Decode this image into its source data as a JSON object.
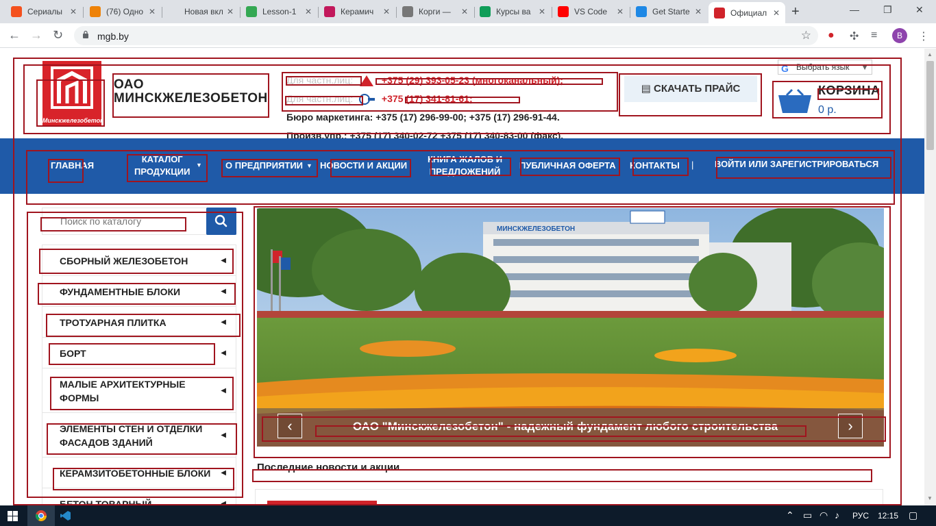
{
  "browser": {
    "tabs": [
      {
        "title": "Сериалы",
        "icon": "fox-icon",
        "color": "#f4511e"
      },
      {
        "title": "(76) Одно",
        "icon": "odnoklassniki-icon",
        "color": "#ee8208"
      },
      {
        "title": "Новая вкладк",
        "icon": "",
        "color": ""
      },
      {
        "title": "Lesson-1",
        "icon": "google-drive-icon",
        "color": "#34a853"
      },
      {
        "title": "Керамич",
        "icon": "ceramic-site-icon",
        "color": "#c2185b"
      },
      {
        "title": "Корги —",
        "icon": "corgi-icon",
        "color": "#777777"
      },
      {
        "title": "Курсы ва",
        "icon": "sheets-icon",
        "color": "#0f9d58"
      },
      {
        "title": "VS Code",
        "icon": "youtube-icon",
        "color": "#ff0000"
      },
      {
        "title": "Get Starte",
        "icon": "vscode-icon",
        "color": "#1e88e5"
      },
      {
        "title": "Официал",
        "icon": "mgb-icon",
        "color": "#d0232a"
      }
    ],
    "url": "mgb.by",
    "profile_initial": "B"
  },
  "site": {
    "company_line1": "ОАО",
    "company_line2": "МИНСКЖЕЛЕЗОБЕТОН",
    "logo_caption": "Минскжелезобетон",
    "phones": {
      "line1_label": "Для частн.лиц:",
      "line1_number": "+375 (29) 393-05-23 (многоканальный);",
      "line2_label": "Для частн.лиц:",
      "line2_number": "+375 (17) 341-81-61;",
      "line3": "Бюро маркетинга: +375 (17) 296-99-00; +375 (17) 296-91-44.",
      "line4": "Произв.упр.: +375 (17) 340-02-72 +375 (17) 340-83-00 (факс)."
    },
    "price_button": "СКАЧАТЬ ПРАЙС",
    "language_button": "Выбрать язык",
    "cart_title": "КОРЗИНА",
    "cart_sum": "0 р.",
    "nav": {
      "home": "ГЛАВНАЯ",
      "catalog_1": "КАТАЛОГ",
      "catalog_2": "ПРОДУКЦИИ",
      "about": "О ПРЕДПРИЯТИИ",
      "news": "НОВОСТИ И АКЦИИ",
      "complaints_1": "КНИГА ЖАЛОВ И",
      "complaints_2": "ПРЕДЛОЖЕНИЙ",
      "offer": "ПУБЛИЧНАЯ ОФЕРТА",
      "contacts": "КОНТАКТЫ",
      "login": "ВОЙТИ ИЛИ ЗАРЕГИСТРИРОВАТЬСЯ"
    },
    "search_placeholder": "Поиск по каталогу",
    "categories": [
      "СБОРНЫЙ ЖЕЛЕЗОБЕТОН",
      "ФУНДАМЕНТНЫЕ БЛОКИ",
      "ТРОТУАРНАЯ ПЛИТКА",
      "БОРТ",
      "МАЛЫЕ АРХИТЕКТУРНЫЕ ФОРМЫ",
      "ЭЛЕМЕНТЫ СТЕН И ОТДЕЛКИ ФАСАДОВ ЗДАНИЙ",
      "КЕРАМЗИТОБЕТОННЫЕ БЛОКИ",
      "БЕТОН ТОВАРНЫЙ"
    ],
    "slide_caption": "ОАО \"Минскжелезобетон\" - надежный фундамент любого строительства",
    "building_sign": "МИНСКЖЕЛЕЗОБЕТОН",
    "news_heading": "Последние новости и акции"
  },
  "taskbar": {
    "lang": "РУС",
    "time": "12:15"
  }
}
